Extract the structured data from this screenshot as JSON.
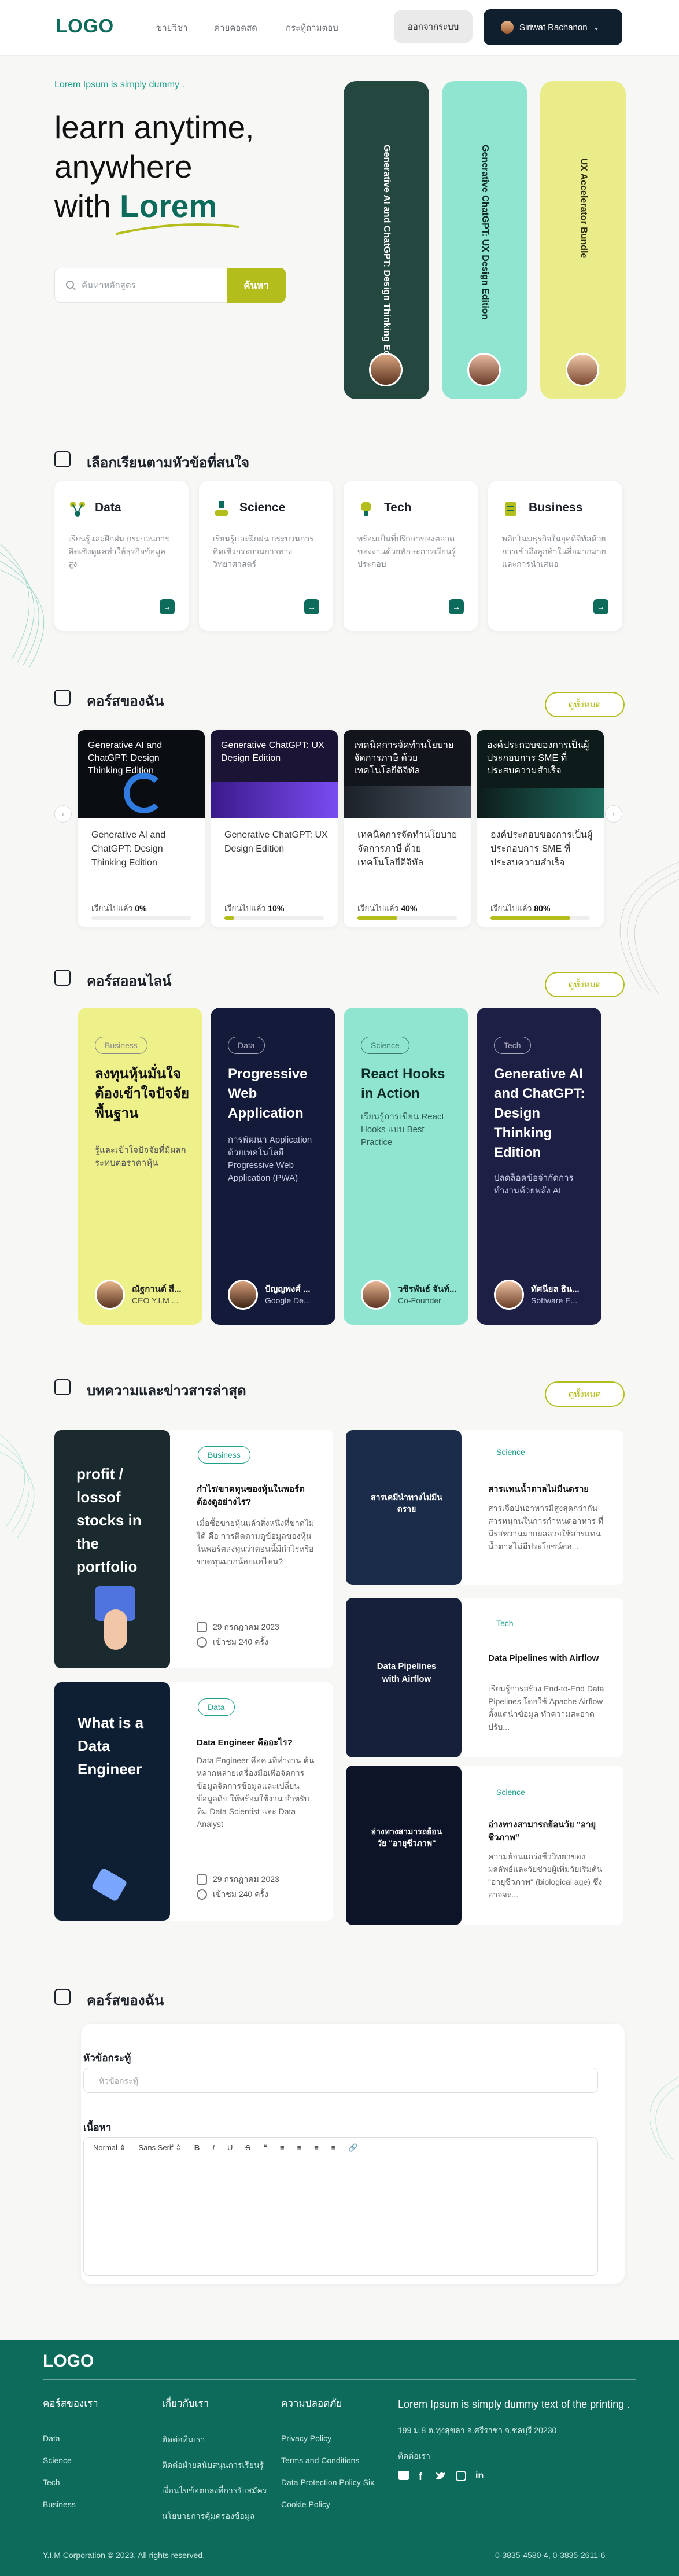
{
  "header": {
    "logo": "LOGO",
    "nav": [
      "ขายวิชา",
      "ค่ายคอดสด",
      "กระทู้ถามตอบ"
    ],
    "login_label": "ออกจากระบบ",
    "user_name": "Siriwat Rachanon"
  },
  "hero": {
    "kicker": "Lorem Ipsum is simply dummy .",
    "title_line1": "learn anytime,",
    "title_line2": "anywhere",
    "title_with": "with",
    "title_highlight": "Lorem",
    "search_placeholder": "ค้นหาหลักสูตร",
    "search_button": "ค้นหา",
    "pills": [
      {
        "title": "Generative AI and ChatGPT: Design Thinking Edition",
        "bg": "#24473f",
        "color": "#ffffff"
      },
      {
        "title": "Generative ChatGPT: UX Design Edition",
        "bg": "#8fe5cf",
        "color": "#0e2a24"
      },
      {
        "title": "UX Accelerator Bundle",
        "bg": "#eaec8a",
        "color": "#2a2b10"
      }
    ]
  },
  "categories": {
    "title": "เลือกเรียนตามหัวข้อที่สนใจ",
    "items": [
      {
        "name": "Data",
        "desc": "เรียนรู้และฝึกฝน กระบวนการคิดเชิงดูแลทำให้ธุรกิจข้อมูลสูง",
        "icon": "data-icon"
      },
      {
        "name": "Science",
        "desc": "เรียนรู้และฝึกฝน กระบวนการคิดเชิงกระบวนการทางวิทยาศาสตร์",
        "icon": "science-icon"
      },
      {
        "name": "Tech",
        "desc": "พร้อมเป็นที่ปรึกษาของตลาดของงานด้วยทักษะการเรียนรู้ประกอบ",
        "icon": "tech-icon"
      },
      {
        "name": "Business",
        "desc": "พลิกโฉมธุรกิจในยุคดิจิทัลด้วยการเข้าถึงลูกค้าในสื่อมากมายและการนำเสนอ",
        "icon": "business-icon"
      }
    ]
  },
  "my_courses": {
    "title": "คอร์สของฉัน",
    "see_all": "ดูทั้งหมด",
    "progress_label": "เรียนไปแล้ว",
    "items": [
      {
        "cover": "Generative AI and ChatGPT: Design Thinking Edition",
        "title": "Generative AI and ChatGPT: Design Thinking Edition",
        "progress": "0%",
        "pct": 0,
        "bg": "#0a0d12",
        "accent": "#2f7be0"
      },
      {
        "cover": "Generative ChatGPT: UX Design Edition",
        "title": "Generative ChatGPT: UX Design Edition",
        "progress": "10%",
        "pct": 10,
        "bg": "#1b1435",
        "accent": "#7a4cf2"
      },
      {
        "cover": "เทคนิคการจัดทำนโยบายจัดการภาษี ด้วยเทคโนโลยีดิจิทัล",
        "title": "เทคนิคการจัดทำนโยบายจัดการภาษี ด้วยเทคโนโลยีดิจิทัล",
        "progress": "40%",
        "pct": 40,
        "bg": "#12161c",
        "accent": "#4b5563"
      },
      {
        "cover": "องค์ประกอบของการเป็นผู้ประกอบการ SME ที่ประสบความสำเร็จ",
        "title": "องค์ประกอบของการเป็นผู้ประกอบการ SME ที่ประสบความสำเร็จ",
        "progress": "80%",
        "pct": 80,
        "bg": "#0d1b1a",
        "accent": "#1f6f61"
      }
    ]
  },
  "online_courses": {
    "title": "คอร์สออนไลน์",
    "see_all": "ดูทั้งหมด",
    "items": [
      {
        "badge": "Business",
        "title": "ลงทุนหุ้นมั่นใจ ต้องเข้าใจปัจจัยพื้นฐาน",
        "desc": "รู้และเข้าใจปัจจัยที่มีผลกระทบต่อราคาหุ้น",
        "name": "ณัฐกานต์ สี...",
        "role": "CEO Y.I.M ...",
        "bg": "#eef08a",
        "color": "#222"
      },
      {
        "badge": "Data",
        "title": "Progressive Web Application",
        "desc": "การพัฒนา Application ด้วยเทคโนโลยี Progressive Web Application (PWA)",
        "name": "ปัญญพงศ์ ...",
        "role": "Google De...",
        "bg": "#141a3a",
        "color": "#ffffff"
      },
      {
        "badge": "Science",
        "title": "React Hooks in Action",
        "desc": "เรียนรู้การเขียน React Hooks แบบ Best Practice",
        "name": "วชิรพันธ์ จันท์...",
        "role": "Co-Founder",
        "bg": "#8fe5cf",
        "color": "#0e2a24"
      },
      {
        "badge": "Tech",
        "title": "Generative AI and ChatGPT: Design Thinking Edition",
        "desc": "ปลดล็อคข้อจำกัดการทำงานด้วยพลัง AI",
        "name": "ทัศนียล ธิน...",
        "role": "Software E...",
        "bg": "#1e1f45",
        "color": "#ffffff"
      }
    ]
  },
  "articles": {
    "title": "บทความและข่าวสารล่าสุด",
    "see_all": "ดูทั้งหมด",
    "big": [
      {
        "cover": "profit / lossof stocks in the portfolio",
        "badge": "Business",
        "title": "กำไร/ขาดทุนของหุ้นในพอร์ต ต้องดูอย่างไร?",
        "desc": "เมื่อซื้อขายหุ้นแล้วสิ่งหนึ่งที่ขาดไม่ได้ คือ การติดตามดูข้อมูลของหุ้นในพอร์ตลงทุนว่าตอนนี้มีกำไรหรือขาดทุนมากน้อยแค่ไหน?",
        "date": "29 กรกฎาคม 2023",
        "views": "เข้าชม 240 ครั้ง"
      },
      {
        "cover": "What is a Data Engineer",
        "badge": "Data",
        "title": "Data Engineer คืออะไร?",
        "desc": "Data Engineer คือคนที่ทำงาน ต้นหลากหลายเครื่องมือเพื่อจัดการข้อมูลจัดการข้อมูลและเปลี่ยนข้อมูลดิบ ให้พร้อมใช้งาน สำหรับทีม Data Scientist และ Data Analyst",
        "date": "29 กรกฎาคม 2023",
        "views": "เข้าชม 240 ครั้ง"
      }
    ],
    "small": [
      {
        "cover": "สารเคมีนำทางไม่มีนตราย",
        "badge": "Science",
        "title": "สารแทนน้ำตาลไม่มีนตราย",
        "desc": "สารเจือปนอาหารมีสูงสุดกว่ากันสารหนุกนในการกำหนดอาหาร ที่มีรสหวานมากผลลวยใช้สารแทนน้ำตาลไม่มีประโยชน์ต่อ..."
      },
      {
        "cover": "Data Pipelines with Airflow",
        "badge": "Tech",
        "title": "Data Pipelines with Airflow",
        "desc": "เรียนรู้การสร้าง End-to-End Data Pipelines โดยใช้ Apache Airflow ตั้งแต่นำข้อมูล ทำความสะอาด ปรับ..."
      },
      {
        "cover": "อ่างทางสามารถย้อนวัย \"อายุชีวภาพ\"",
        "badge": "Science",
        "title": "อ่างทางสามารถย้อนวัย \"อายุชีวภาพ\"",
        "desc": "ความย้อนแกร่งชีววิทยาของผลลัพธ์และวัยช่วยผู้เพิ่มวัยเริ่มต้น \"อายุชีวภาพ\" (biological age) ซึ่งอาจจะ..."
      }
    ]
  },
  "post_form": {
    "title": "คอร์สของฉัน",
    "topic_label": "หัวข้อกระทู้",
    "topic_placeholder": "หัวข้อกระทู้",
    "content_label": "เนื้อหา",
    "editor_style": "Normal",
    "editor_font": "Sans Serif"
  },
  "footer": {
    "logo": "LOGO",
    "columns": [
      {
        "title": "คอร์สของเรา",
        "items": [
          "Data",
          "Science",
          "Tech",
          "Business"
        ]
      },
      {
        "title": "เกี่ยวกับเรา",
        "items": [
          "ติดต่อทีมเรา",
          "ติดต่อฝ่ายสนับสนุนการเรียนรู้",
          "เงื่อนไขข้อตกลงที่การรับสมัคร",
          "นโยบายการคุ้มครองข้อมูล"
        ]
      },
      {
        "title": "ความปลอดภัย",
        "items": [
          "Privacy Policy",
          "Terms and Conditions",
          "Data Protection Policy Six",
          "Cookie Policy"
        ]
      }
    ],
    "about": "Lorem Ipsum is simply dummy text of the printing .",
    "address": "199 ม.8 ต.ทุ่งสุขลา อ.ศรีราชา จ.ชลบุรี 20230",
    "contact": "ติดต่อเรา",
    "copyright": "Y.I.M Corporation © 2023. All rights reserved.",
    "phone": "0-3835-4580-4, 0-3835-2611-6"
  }
}
